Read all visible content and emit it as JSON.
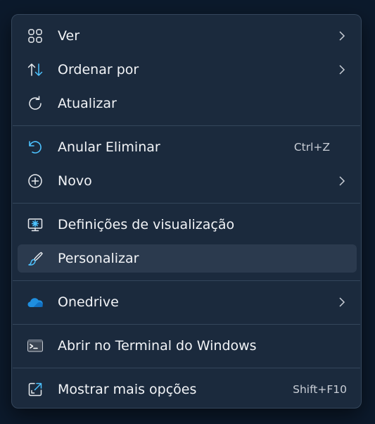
{
  "menu": {
    "items": {
      "view": {
        "label": "Ver",
        "icon": "grid-view-icon",
        "has_submenu": true
      },
      "sort": {
        "label": "Ordenar por",
        "icon": "sort-arrows-icon",
        "has_submenu": true
      },
      "refresh": {
        "label": "Atualizar",
        "icon": "refresh-icon",
        "has_submenu": false
      },
      "undo": {
        "label": "Anular Eliminar",
        "shortcut": "Ctrl+Z",
        "icon": "undo-icon"
      },
      "new": {
        "label": "Novo",
        "icon": "plus-circle-icon",
        "has_submenu": true
      },
      "display": {
        "label": "Definições de visualização",
        "icon": "display-settings-icon"
      },
      "personalize": {
        "label": "Personalizar",
        "icon": "brush-icon",
        "hovered": true
      },
      "onedrive": {
        "label": "Onedrive",
        "icon": "onedrive-cloud-icon",
        "has_submenu": true
      },
      "terminal": {
        "label": "Abrir no Terminal do Windows",
        "icon": "terminal-icon"
      },
      "more": {
        "label": "Mostrar mais opções",
        "shortcut": "Shift+F10",
        "icon": "show-more-options-icon"
      }
    }
  },
  "colors": {
    "menu_bg": "#1b2a3d",
    "hover_bg": "#2b3a4e",
    "separator": "#34465b",
    "text": "#f2f4f7",
    "accent": "#4cc2ff",
    "onedrive": "#1f8fe0"
  }
}
